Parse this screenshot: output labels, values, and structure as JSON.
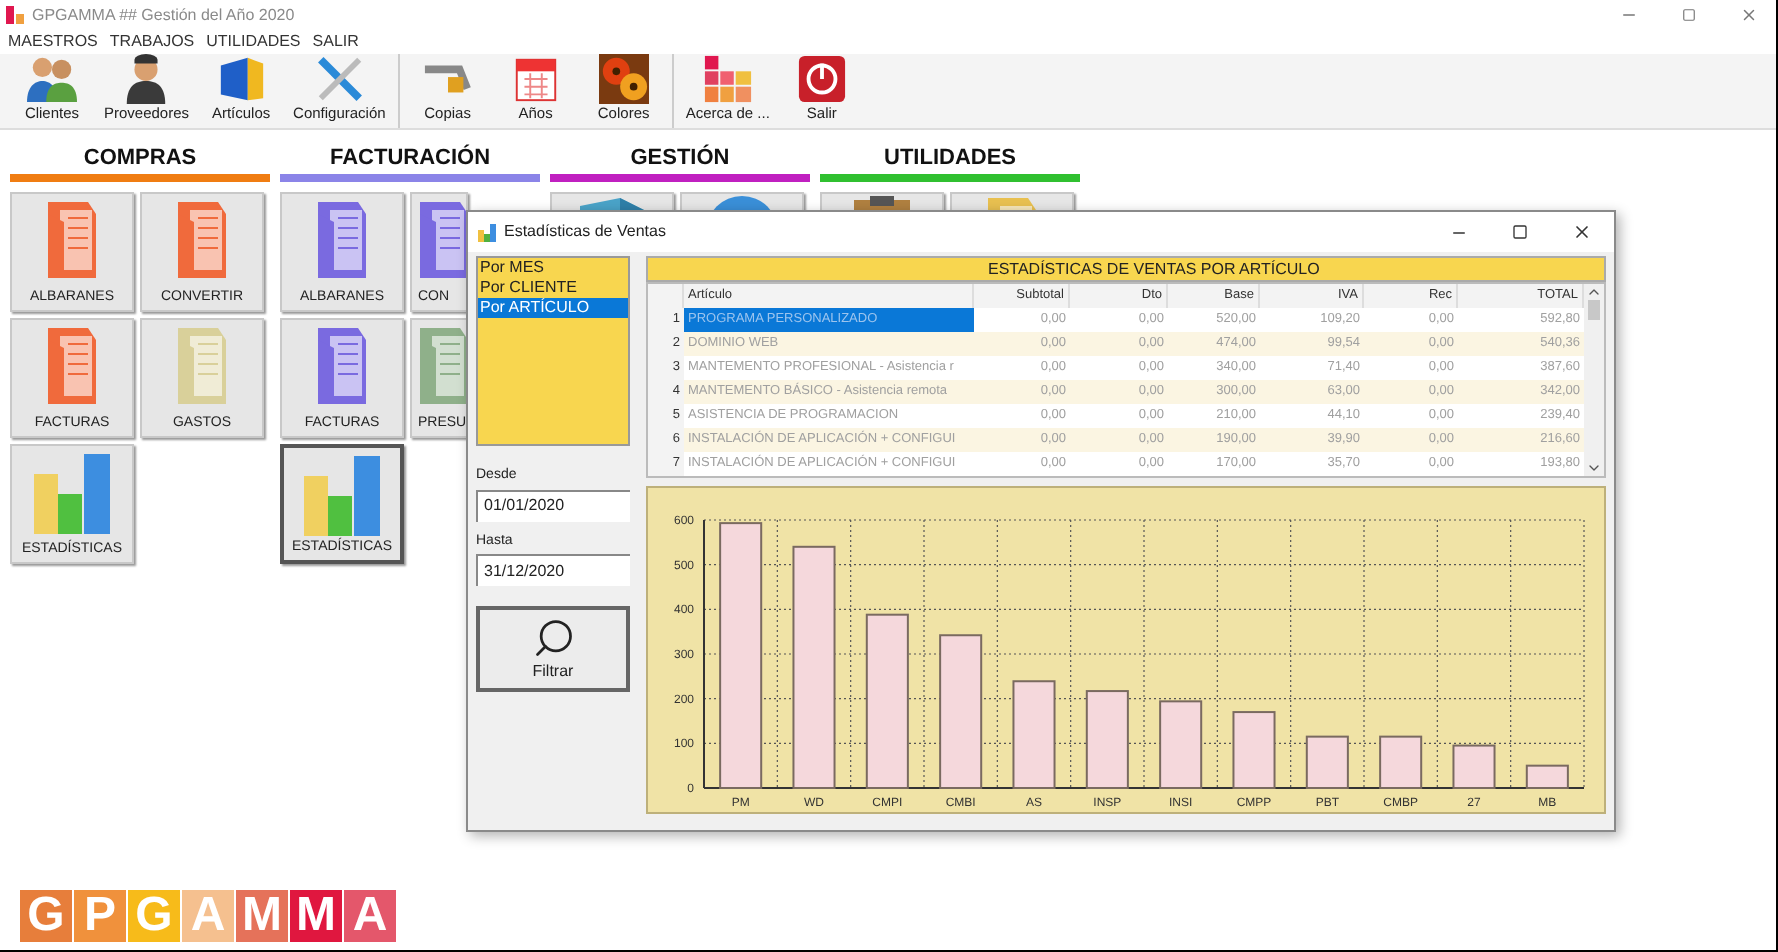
{
  "window": {
    "title": "GPGAMMA ## Gestión del Año 2020"
  },
  "menu": [
    {
      "label": "MAESTROS"
    },
    {
      "label": "TRABAJOS"
    },
    {
      "label": "UTILIDADES"
    },
    {
      "label": "SALIR"
    }
  ],
  "toolbar": {
    "groups": [
      [
        {
          "label": "Clientes"
        },
        {
          "label": "Proveedores"
        },
        {
          "label": "Artículos"
        },
        {
          "label": "Configuración"
        }
      ],
      [
        {
          "label": "Copias"
        },
        {
          "label": "Años"
        },
        {
          "label": "Colores"
        }
      ],
      [
        {
          "label": "Acerca de ..."
        },
        {
          "label": "Salir"
        }
      ]
    ]
  },
  "sections": [
    {
      "title": "COMPRAS",
      "color": "#f07d12",
      "tiles": [
        {
          "label": "ALBARANES",
          "kind": "folder",
          "color": "#f06a3c",
          "selected": false
        },
        {
          "label": "CONVERTIR",
          "kind": "folder",
          "color": "#f06a3c",
          "selected": false
        },
        {
          "label": "FACTURAS",
          "kind": "folder",
          "color": "#f06a3c",
          "selected": false
        },
        {
          "label": "GASTOS",
          "kind": "folder",
          "color": "#d9d09a",
          "selected": false
        },
        {
          "label": "ESTADÍSTICAS",
          "kind": "chart",
          "color": "#3d8ee0",
          "selected": false
        }
      ]
    },
    {
      "title": "FACTURACIÓN",
      "color": "#8b84e8",
      "tiles": [
        {
          "label": "ALBARANES",
          "kind": "folder",
          "color": "#7a6ae0",
          "selected": false
        },
        {
          "label": "CON",
          "kind": "folder",
          "color": "#7a6ae0",
          "selected": false
        },
        {
          "label": "FACTURAS",
          "kind": "folder",
          "color": "#7a6ae0",
          "selected": false
        },
        {
          "label": "PRESU",
          "kind": "folder",
          "color": "#8fb08a",
          "selected": false
        },
        {
          "label": "ESTADÍSTICAS",
          "kind": "chart",
          "color": "#3d8ee0",
          "selected": true
        }
      ]
    },
    {
      "title": "GESTIÓN",
      "color": "#c020c0",
      "tiles": [
        {
          "kind": "cube",
          "color": "#4aa3c8",
          "selected": false
        },
        {
          "kind": "globe",
          "color": "#3a8fd8",
          "selected": false
        }
      ]
    },
    {
      "title": "UTILIDADES",
      "color": "#30c030",
      "tiles": [
        {
          "kind": "clipboard",
          "color": "#b08040",
          "selected": false
        },
        {
          "kind": "folder",
          "color": "#e8c050",
          "selected": false
        }
      ]
    }
  ],
  "dialog": {
    "title": "Estadísticas de Ventas",
    "options": [
      {
        "label": "Por MES",
        "selected": false
      },
      {
        "label": "Por CLIENTE",
        "selected": false
      },
      {
        "label": "Por ARTÍCULO",
        "selected": true
      }
    ],
    "desde": {
      "label": "Desde",
      "value": "01/01/2020"
    },
    "hasta": {
      "label": "Hasta",
      "value": "31/12/2020"
    },
    "filter_button": "Filtrar",
    "table": {
      "title": "ESTADÍSTICAS DE VENTAS POR ARTÍCULO",
      "columns": [
        "Artículo",
        "Subtotal",
        "Dto",
        "Base",
        "IVA",
        "Rec",
        "TOTAL"
      ],
      "rows": [
        {
          "num": "1",
          "selected": true,
          "cells": [
            "PROGRAMA PERSONALIZADO",
            "0,00",
            "0,00",
            "520,00",
            "109,20",
            "0,00",
            "592,80"
          ]
        },
        {
          "num": "2",
          "selected": false,
          "cells": [
            "DOMINIO WEB",
            "0,00",
            "0,00",
            "474,00",
            "99,54",
            "0,00",
            "540,36"
          ]
        },
        {
          "num": "3",
          "selected": false,
          "cells": [
            "MANTEMENTO PROFESIONAL - Asistencia r",
            "0,00",
            "0,00",
            "340,00",
            "71,40",
            "0,00",
            "387,60"
          ]
        },
        {
          "num": "4",
          "selected": false,
          "cells": [
            "MANTEMENTO BÁSICO - Asistencia remota",
            "0,00",
            "0,00",
            "300,00",
            "63,00",
            "0,00",
            "342,00"
          ]
        },
        {
          "num": "5",
          "selected": false,
          "cells": [
            "ASISTENCIA DE PROGRAMACION",
            "0,00",
            "0,00",
            "210,00",
            "44,10",
            "0,00",
            "239,40"
          ]
        },
        {
          "num": "6",
          "selected": false,
          "cells": [
            "INSTALACIÓN DE APLICACIÓN + CONFIGUI",
            "0,00",
            "0,00",
            "190,00",
            "39,90",
            "0,00",
            "216,60"
          ]
        },
        {
          "num": "7",
          "selected": false,
          "cells": [
            "INSTALACIÓN DE APLICACIÓN + CONFIGUI",
            "0,00",
            "0,00",
            "170,00",
            "35,70",
            "0,00",
            "193,80"
          ]
        }
      ]
    },
    "chart_data": {
      "type": "bar",
      "categories": [
        "PM",
        "WD",
        "CMPI",
        "CMBI",
        "AS",
        "INSP",
        "INSI",
        "CMPP",
        "PBT",
        "CMBP",
        "27",
        "MB"
      ],
      "series": [
        {
          "color": "#f5d8dc",
          "values": [
            593,
            540,
            388,
            342,
            239,
            217,
            194,
            170,
            115,
            115,
            95,
            50
          ]
        }
      ],
      "grid": true,
      "ylim": [
        0,
        600
      ],
      "yticks": [
        0,
        100,
        200,
        300,
        400,
        500,
        600
      ]
    }
  },
  "logo": [
    {
      "char": "G",
      "color": "#e77e3b"
    },
    {
      "char": "P",
      "color": "#f0913c"
    },
    {
      "char": "G",
      "color": "#f7bb1a"
    },
    {
      "char": "A",
      "color": "#f5c08f"
    },
    {
      "char": "M",
      "color": "#e5725a"
    },
    {
      "char": "M",
      "color": "#e0173f"
    },
    {
      "char": "A",
      "color": "#e4576b"
    }
  ]
}
